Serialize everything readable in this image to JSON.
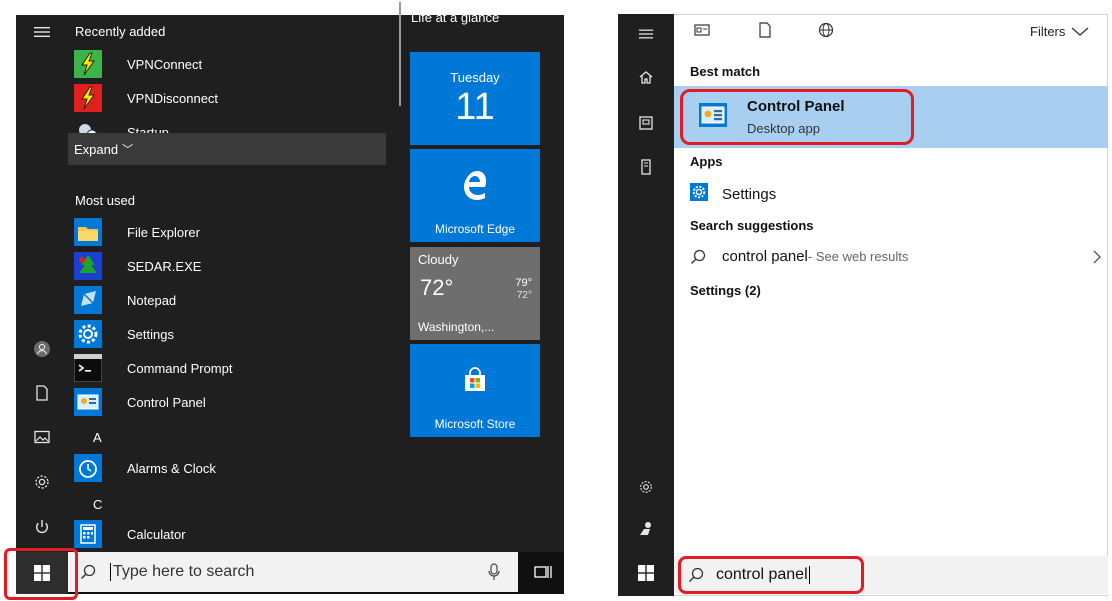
{
  "left_panel": {
    "recently_added_heading": "Recently added",
    "recent_apps": [
      {
        "label": "VPNConnect",
        "icon": "vpn-connect-icon"
      },
      {
        "label": "VPNDisconnect",
        "icon": "vpn-disconnect-icon"
      },
      {
        "label": "Startup",
        "icon": "startup-icon"
      }
    ],
    "expand_label": "Expand",
    "expand_chevron": "﹀",
    "most_used_heading": "Most used",
    "most_used_apps": [
      {
        "label": "File Explorer",
        "icon": "file-explorer-icon"
      },
      {
        "label": "SEDAR.EXE",
        "icon": "sedar-icon"
      },
      {
        "label": "Notepad",
        "icon": "notepad-icon"
      },
      {
        "label": "Settings",
        "icon": "settings-gear-icon"
      },
      {
        "label": "Command Prompt",
        "icon": "command-prompt-icon"
      },
      {
        "label": "Control Panel",
        "icon": "control-panel-icon"
      }
    ],
    "letter_a": "A",
    "letter_c": "C",
    "alpha_apps": [
      {
        "label": "Alarms & Clock",
        "icon": "alarm-clock-icon"
      },
      {
        "label": "Calculator",
        "icon": "calculator-icon"
      }
    ],
    "life_at_a_glance": "Life at a glance",
    "calendar_tile": {
      "day": "Tuesday",
      "date": "11"
    },
    "edge_tile": {
      "label": "Microsoft Edge"
    },
    "weather_tile": {
      "condition": "Cloudy",
      "temp": "72°",
      "high": "79°",
      "low": "72°",
      "location": "Washington,..."
    },
    "store_tile": {
      "label": "Microsoft Store"
    },
    "search_placeholder": "Type here to search"
  },
  "right_panel": {
    "filters_label": "Filters",
    "best_match_heading": "Best match",
    "best_match": {
      "title": "Control Panel",
      "subtitle": "Desktop app"
    },
    "apps_heading": "Apps",
    "apps": [
      {
        "label": "Settings"
      }
    ],
    "suggestions_heading": "Search suggestions",
    "suggestion": {
      "query": "control panel",
      "hint": " - See web results"
    },
    "settings_heading": "Settings (2)",
    "search_value": "control panel"
  },
  "colors": {
    "accent": "#0078d7",
    "highlight": "#a8cff0",
    "annotation": "#e31b23",
    "start_bg": "#1f1f1f"
  }
}
